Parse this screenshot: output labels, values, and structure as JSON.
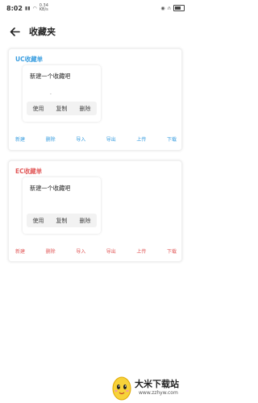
{
  "status_bar": {
    "time": "8:02",
    "mini_line1": "0.34",
    "mini_line2": "KB/s"
  },
  "header": {
    "back_icon": "arrow-left-icon",
    "title": "收藏夹"
  },
  "uc_card": {
    "title": "UC收藏单",
    "title_color": "#3a9ee0",
    "item_title": "新建一个收藏吧",
    "dot": ".",
    "actions": [
      "使用",
      "复制",
      "删除"
    ],
    "toolbar": [
      "新建",
      "删除",
      "导入",
      "导出",
      "上传",
      "下载"
    ],
    "toolbar_color": "#3a9ee0"
  },
  "ec_card": {
    "title": "EC收藏单",
    "title_color": "#e25a5a",
    "item_title": "新建一个收藏吧",
    "actions": [
      "使用",
      "复制",
      "删除"
    ],
    "toolbar": [
      "新建",
      "删除",
      "导入",
      "导出",
      "上传",
      "下载"
    ],
    "toolbar_color": "#e25a5a"
  },
  "watermark": {
    "title": "大米下载站",
    "url": "www.zzhyw.com"
  }
}
